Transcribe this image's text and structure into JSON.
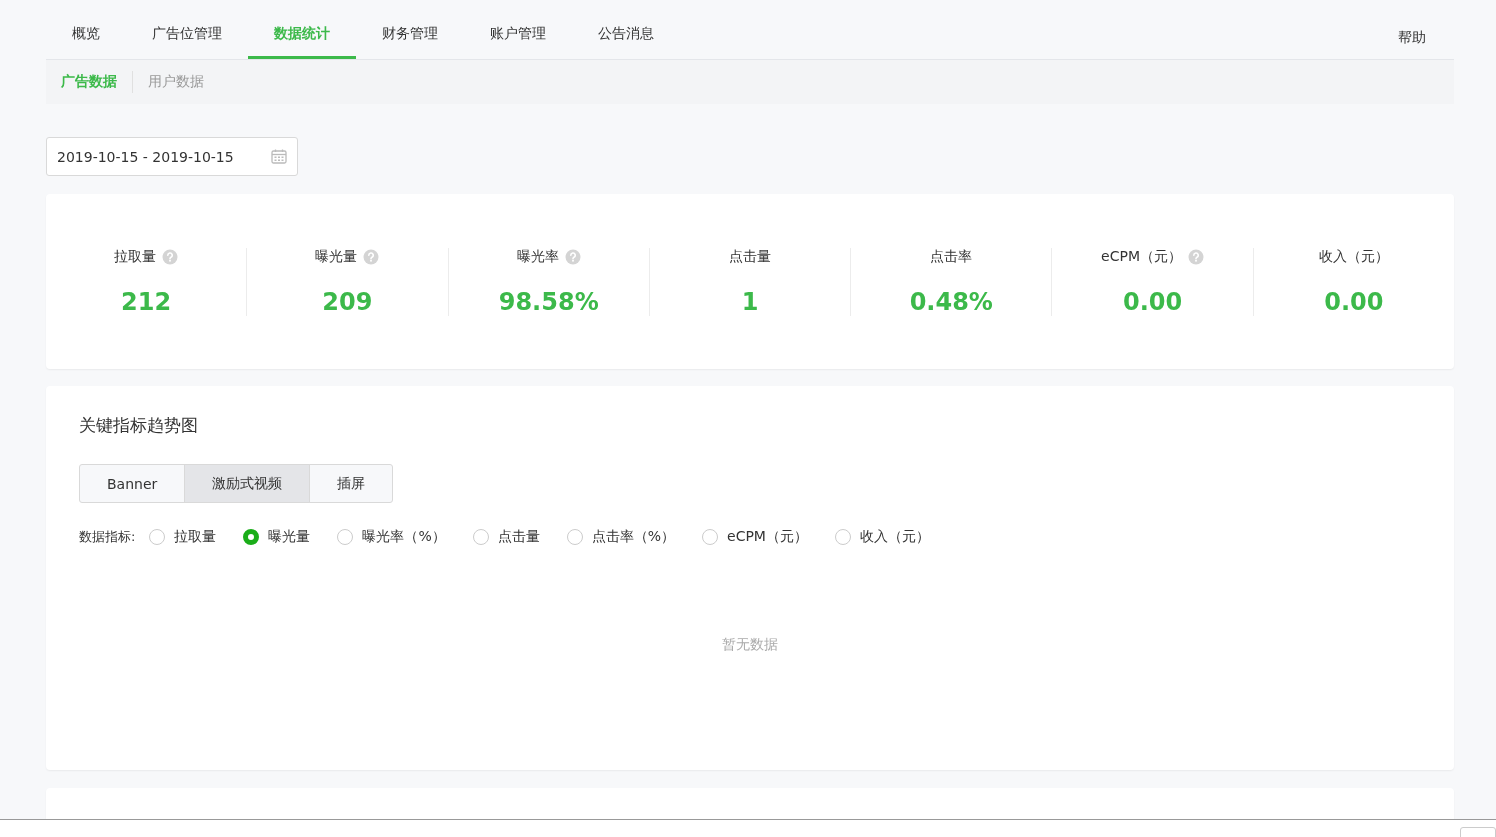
{
  "nav": {
    "tabs": [
      {
        "label": "概览",
        "selected": false
      },
      {
        "label": "广告位管理",
        "selected": false
      },
      {
        "label": "数据统计",
        "selected": true
      },
      {
        "label": "财务管理",
        "selected": false
      },
      {
        "label": "账户管理",
        "selected": false
      },
      {
        "label": "公告消息",
        "selected": false
      }
    ],
    "help": "帮助"
  },
  "subnav": [
    {
      "label": "广告数据",
      "selected": true
    },
    {
      "label": "用户数据",
      "selected": false
    }
  ],
  "date_range": {
    "value": "2019-10-15 - 2019-10-15"
  },
  "metrics": [
    {
      "label": "拉取量",
      "help": true,
      "value": "212"
    },
    {
      "label": "曝光量",
      "help": true,
      "value": "209"
    },
    {
      "label": "曝光率",
      "help": true,
      "value": "98.58%"
    },
    {
      "label": "点击量",
      "help": false,
      "value": "1"
    },
    {
      "label": "点击率",
      "help": false,
      "value": "0.48%"
    },
    {
      "label": "eCPM（元）",
      "help": true,
      "value": "0.00"
    },
    {
      "label": "收入（元）",
      "help": false,
      "value": "0.00"
    }
  ],
  "trend": {
    "title": "关键指标趋势图",
    "ad_types": [
      {
        "label": "Banner",
        "selected": false
      },
      {
        "label": "激励式视频",
        "selected": true
      },
      {
        "label": "插屏",
        "selected": false
      }
    ],
    "metric_label": "数据指标:",
    "metric_options": [
      {
        "label": "拉取量",
        "selected": false
      },
      {
        "label": "曝光量",
        "selected": true
      },
      {
        "label": "曝光率（%）",
        "selected": false
      },
      {
        "label": "点击量",
        "selected": false
      },
      {
        "label": "点击率（%）",
        "selected": false
      },
      {
        "label": "eCPM（元）",
        "selected": false
      },
      {
        "label": "收入（元）",
        "selected": false
      }
    ],
    "empty_text": "暂无数据"
  }
}
